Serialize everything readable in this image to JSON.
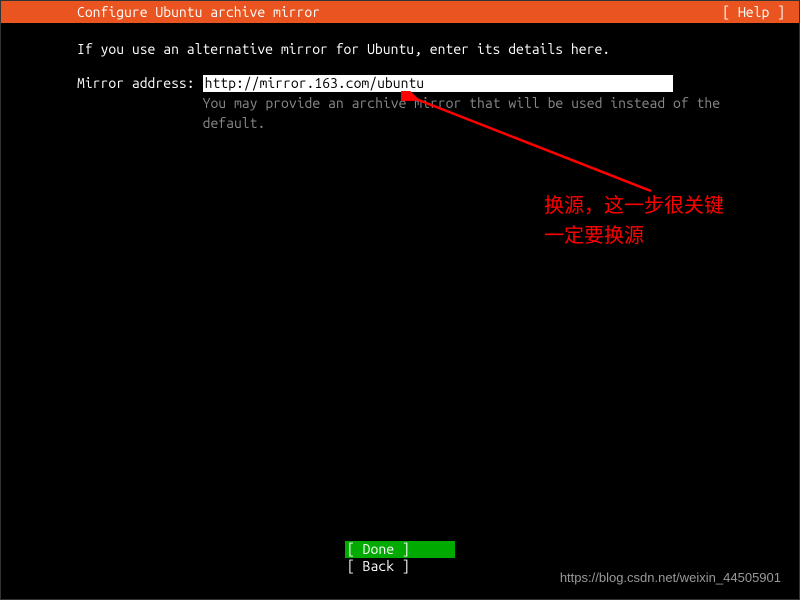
{
  "header": {
    "title": "Configure Ubuntu archive mirror",
    "help_label": "[ Help ]"
  },
  "content": {
    "instruction": "If you use an alternative mirror for Ubuntu, enter its details here.",
    "form": {
      "label": "Mirror address:",
      "value": "http://mirror.163.com/ubuntu",
      "help_text": "You may provide an archive mirror that will be used instead of the default."
    }
  },
  "buttons": {
    "done_label": "[ Done       ]",
    "back_label": "[ Back       ]"
  },
  "annotation": {
    "line1": "换源，这一步很关键",
    "line2": "一定要换源"
  },
  "watermark": "https://blog.csdn.net/weixin_44505901"
}
